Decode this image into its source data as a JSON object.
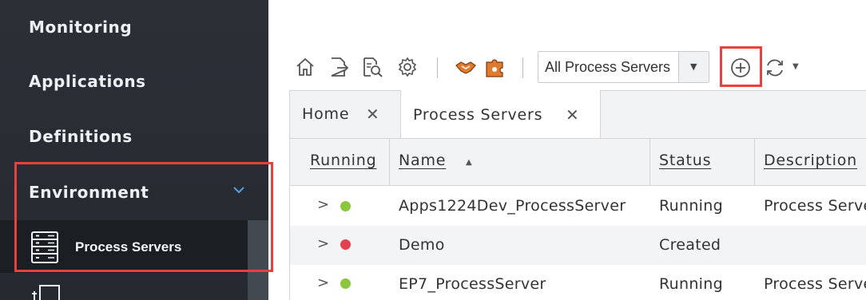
{
  "sidebar": {
    "items": [
      {
        "label": "Monitoring"
      },
      {
        "label": "Applications"
      },
      {
        "label": "Definitions"
      },
      {
        "label": "Environment",
        "expanded": true
      }
    ],
    "subitems": [
      {
        "label": "Process Servers",
        "icon": "server-rack-icon",
        "active": true
      }
    ]
  },
  "toolbar": {
    "icons": [
      "home-icon",
      "export-icon",
      "search-document-icon",
      "gear-icon",
      "handshake-icon",
      "puzzle-icon",
      "add-icon",
      "refresh-icon"
    ],
    "filter_value": "All Process Servers"
  },
  "tabs": [
    {
      "label": "Home"
    },
    {
      "label": "Process Servers",
      "active": true
    }
  ],
  "grid": {
    "columns": [
      "Running",
      "Name",
      "Status",
      "Description"
    ],
    "sort": {
      "column": "Name",
      "direction": "ascending"
    },
    "rows": [
      {
        "running": "green",
        "name": "Apps1224Dev_ProcessServer",
        "status": "Running",
        "description": "Process Serve"
      },
      {
        "running": "red",
        "name": "Demo",
        "status": "Created",
        "description": ""
      },
      {
        "running": "green",
        "name": "EP7_ProcessServer",
        "status": "Running",
        "description": "Process Serve"
      }
    ]
  },
  "colors": {
    "highlight": "#e8403f",
    "sidebar_bg": "#282d34",
    "running_green": "#8cc63f",
    "created_red": "#e0424f"
  }
}
